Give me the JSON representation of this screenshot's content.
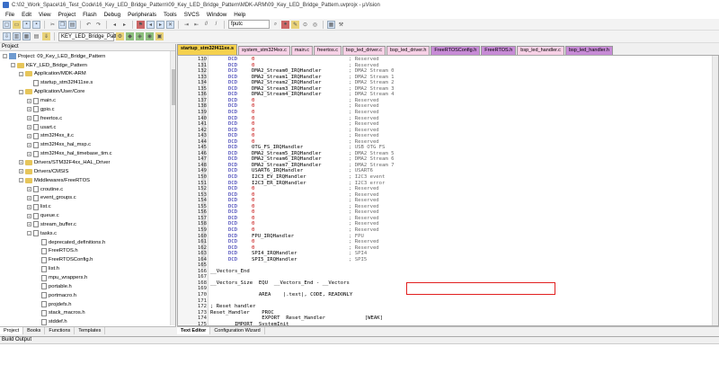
{
  "window": {
    "title": "C:\\02_Work_Space\\16_Test_Code\\16_Key_LED_Bridge_Pattern\\09_Key_LED_Bridge_Pattern\\MDK-ARM\\09_Key_LED_Bridge_Pattern.uvprojx - µVision"
  },
  "menu": [
    "File",
    "Edit",
    "View",
    "Project",
    "Flash",
    "Debug",
    "Peripherals",
    "Tools",
    "SVCS",
    "Window",
    "Help"
  ],
  "toolbar": {
    "find_value": "fputc",
    "target": "KEY_LED_Bridge_Pattern"
  },
  "project_panel": {
    "title": "Project",
    "tree": [
      {
        "label": "Project: 09_Key_LED_Bridge_Pattern",
        "level": 0,
        "kind": "proj",
        "exp": "-"
      },
      {
        "label": "KEY_LED_Bridge_Pattern",
        "level": 1,
        "kind": "fold",
        "exp": "-"
      },
      {
        "label": "Application/MDK-ARM",
        "level": 2,
        "kind": "fold",
        "exp": "-"
      },
      {
        "label": "startup_stm32f411xe.s",
        "level": 3,
        "kind": "file",
        "exp": ""
      },
      {
        "label": "Application/User/Core",
        "level": 2,
        "kind": "fold",
        "exp": "-"
      },
      {
        "label": "main.c",
        "level": 3,
        "kind": "file",
        "exp": "+"
      },
      {
        "label": "gpio.c",
        "level": 3,
        "kind": "file",
        "exp": "+"
      },
      {
        "label": "freertos.c",
        "level": 3,
        "kind": "file",
        "exp": "+"
      },
      {
        "label": "usart.c",
        "level": 3,
        "kind": "file",
        "exp": "+"
      },
      {
        "label": "stm32f4xx_it.c",
        "level": 3,
        "kind": "file",
        "exp": "+"
      },
      {
        "label": "stm32f4xx_hal_msp.c",
        "level": 3,
        "kind": "file",
        "exp": "+"
      },
      {
        "label": "stm32f4xx_hal_timebase_tim.c",
        "level": 3,
        "kind": "file",
        "exp": "+"
      },
      {
        "label": "Drivers/STM32F4xx_HAL_Driver",
        "level": 2,
        "kind": "fold",
        "exp": "+"
      },
      {
        "label": "Drivers/CMSIS",
        "level": 2,
        "kind": "fold",
        "exp": "+"
      },
      {
        "label": "Middlewares/FreeRTOS",
        "level": 2,
        "kind": "fold",
        "exp": "-"
      },
      {
        "label": "croutine.c",
        "level": 3,
        "kind": "file",
        "exp": "+"
      },
      {
        "label": "event_groups.c",
        "level": 3,
        "kind": "file",
        "exp": "+"
      },
      {
        "label": "list.c",
        "level": 3,
        "kind": "file",
        "exp": "+"
      },
      {
        "label": "queue.c",
        "level": 3,
        "kind": "file",
        "exp": "+"
      },
      {
        "label": "stream_buffer.c",
        "level": 3,
        "kind": "file",
        "exp": "+"
      },
      {
        "label": "tasks.c",
        "level": 3,
        "kind": "file",
        "exp": "-"
      },
      {
        "label": "deprecated_definitions.h",
        "level": 4,
        "kind": "file",
        "exp": ""
      },
      {
        "label": "FreeRTOS.h",
        "level": 4,
        "kind": "file",
        "exp": ""
      },
      {
        "label": "FreeRTOSConfig.h",
        "level": 4,
        "kind": "file",
        "exp": ""
      },
      {
        "label": "list.h",
        "level": 4,
        "kind": "file",
        "exp": ""
      },
      {
        "label": "mpu_wrappers.h",
        "level": 4,
        "kind": "file",
        "exp": ""
      },
      {
        "label": "portable.h",
        "level": 4,
        "kind": "file",
        "exp": ""
      },
      {
        "label": "portmacro.h",
        "level": 4,
        "kind": "file",
        "exp": ""
      },
      {
        "label": "projdefs.h",
        "level": 4,
        "kind": "file",
        "exp": ""
      },
      {
        "label": "stack_macros.h",
        "level": 4,
        "kind": "file",
        "exp": ""
      },
      {
        "label": "stddef.h",
        "level": 4,
        "kind": "file",
        "exp": ""
      }
    ],
    "tabs": [
      "Project",
      "Books",
      "Functions",
      "Templates"
    ]
  },
  "editor": {
    "tabs": [
      {
        "label": "startup_stm32f411xe.s",
        "color": "#f5d14e",
        "active": true
      },
      {
        "label": "system_stm32f4xx.c",
        "color": "#f7d1e6"
      },
      {
        "label": "main.c",
        "color": "#f7d1e6"
      },
      {
        "label": "freertos.c",
        "color": "#f7d1e6"
      },
      {
        "label": "bsp_led_driver.c",
        "color": "#f7d1e6"
      },
      {
        "label": "bsp_led_driver.h",
        "color": "#f7d1e6"
      },
      {
        "label": "FreeRTOSConfig.h",
        "color": "#c78bd6"
      },
      {
        "label": "FreeRTOS.h",
        "color": "#c78bd6"
      },
      {
        "label": "bsp_led_handler.c",
        "color": "#f7d1e6"
      },
      {
        "label": "bsp_led_handler.h",
        "color": "#c78bd6"
      }
    ],
    "lines": [
      {
        "n": "130",
        "kw": "DCD",
        "op": "0",
        "cm": "; Reserved"
      },
      {
        "n": "131",
        "kw": "DCD",
        "op": "0",
        "cm": "; Reserved"
      },
      {
        "n": "132",
        "kw": "DCD",
        "op": "DMA2_Stream0_IRQHandler",
        "cm": "; DMA2 Stream 0"
      },
      {
        "n": "133",
        "kw": "DCD",
        "op": "DMA2_Stream1_IRQHandler",
        "cm": "; DMA2 Stream 1"
      },
      {
        "n": "134",
        "kw": "DCD",
        "op": "DMA2_Stream2_IRQHandler",
        "cm": "; DMA2 Stream 2"
      },
      {
        "n": "135",
        "kw": "DCD",
        "op": "DMA2_Stream3_IRQHandler",
        "cm": "; DMA2 Stream 3"
      },
      {
        "n": "136",
        "kw": "DCD",
        "op": "DMA2_Stream4_IRQHandler",
        "cm": "; DMA2 Stream 4"
      },
      {
        "n": "137",
        "kw": "DCD",
        "op": "0",
        "cm": "; Reserved"
      },
      {
        "n": "138",
        "kw": "DCD",
        "op": "0",
        "cm": "; Reserved"
      },
      {
        "n": "139",
        "kw": "DCD",
        "op": "0",
        "cm": "; Reserved"
      },
      {
        "n": "140",
        "kw": "DCD",
        "op": "0",
        "cm": "; Reserved"
      },
      {
        "n": "141",
        "kw": "DCD",
        "op": "0",
        "cm": "; Reserved"
      },
      {
        "n": "142",
        "kw": "DCD",
        "op": "0",
        "cm": "; Reserved"
      },
      {
        "n": "143",
        "kw": "DCD",
        "op": "0",
        "cm": "; Reserved"
      },
      {
        "n": "144",
        "kw": "DCD",
        "op": "0",
        "cm": "; Reserved"
      },
      {
        "n": "145",
        "kw": "DCD",
        "op": "OTG_FS_IRQHandler",
        "cm": "; USB OTG FS"
      },
      {
        "n": "146",
        "kw": "DCD",
        "op": "DMA2_Stream5_IRQHandler",
        "cm": "; DMA2 Stream 5"
      },
      {
        "n": "147",
        "kw": "DCD",
        "op": "DMA2_Stream6_IRQHandler",
        "cm": "; DMA2 Stream 6"
      },
      {
        "n": "148",
        "kw": "DCD",
        "op": "DMA2_Stream7_IRQHandler",
        "cm": "; DMA2 Stream 7"
      },
      {
        "n": "149",
        "kw": "DCD",
        "op": "USART6_IRQHandler",
        "cm": "; USART6"
      },
      {
        "n": "150",
        "kw": "DCD",
        "op": "I2C3_EV_IRQHandler",
        "cm": "; I2C3 event"
      },
      {
        "n": "151",
        "kw": "DCD",
        "op": "I2C3_ER_IRQHandler",
        "cm": "; I2C3 error"
      },
      {
        "n": "152",
        "kw": "DCD",
        "op": "0",
        "cm": "; Reserved"
      },
      {
        "n": "153",
        "kw": "DCD",
        "op": "0",
        "cm": "; Reserved"
      },
      {
        "n": "154",
        "kw": "DCD",
        "op": "0",
        "cm": "; Reserved"
      },
      {
        "n": "155",
        "kw": "DCD",
        "op": "0",
        "cm": "; Reserved"
      },
      {
        "n": "156",
        "kw": "DCD",
        "op": "0",
        "cm": "; Reserved"
      },
      {
        "n": "157",
        "kw": "DCD",
        "op": "0",
        "cm": "; Reserved"
      },
      {
        "n": "158",
        "kw": "DCD",
        "op": "0",
        "cm": "; Reserved"
      },
      {
        "n": "159",
        "kw": "DCD",
        "op": "0",
        "cm": "; Reserved"
      },
      {
        "n": "160",
        "kw": "DCD",
        "op": "FPU_IRQHandler",
        "cm": "; FPU"
      },
      {
        "n": "161",
        "kw": "DCD",
        "op": "0",
        "cm": "; Reserved"
      },
      {
        "n": "162",
        "kw": "DCD",
        "op": "0",
        "cm": "; Reserved"
      },
      {
        "n": "163",
        "kw": "DCD",
        "op": "SPI4_IRQHandler",
        "cm": "; SPI4"
      },
      {
        "n": "164",
        "kw": "DCD",
        "op": "SPI5_IRQHandler",
        "cm": "; SPI5"
      },
      {
        "n": "165",
        "kw": "",
        "op": "",
        "cm": ""
      },
      {
        "n": "166",
        "raw": "__Vectors_End"
      },
      {
        "n": "167",
        "raw": ""
      },
      {
        "n": "168",
        "raw": "__Vectors_Size  EQU  __Vectors_End - __Vectors"
      },
      {
        "n": "169",
        "raw": ""
      },
      {
        "n": "170",
        "raw": "                AREA    |.text|, CODE, READONLY"
      },
      {
        "n": "171",
        "raw": ""
      },
      {
        "n": "172",
        "raw": "; Reset handler"
      },
      {
        "n": "173",
        "raw": "Reset_Handler    PROC"
      },
      {
        "n": "174",
        "raw": "                 EXPORT  Reset_Handler             [WEAK]"
      },
      {
        "n": "175",
        "raw": "        IMPORT  SystemInit"
      },
      {
        "n": "176",
        "raw": "        IMPORT  __main"
      }
    ],
    "bottom_tabs": [
      "Text Editor",
      "Configuration Wizard"
    ]
  },
  "build": {
    "title": "Build Output"
  }
}
